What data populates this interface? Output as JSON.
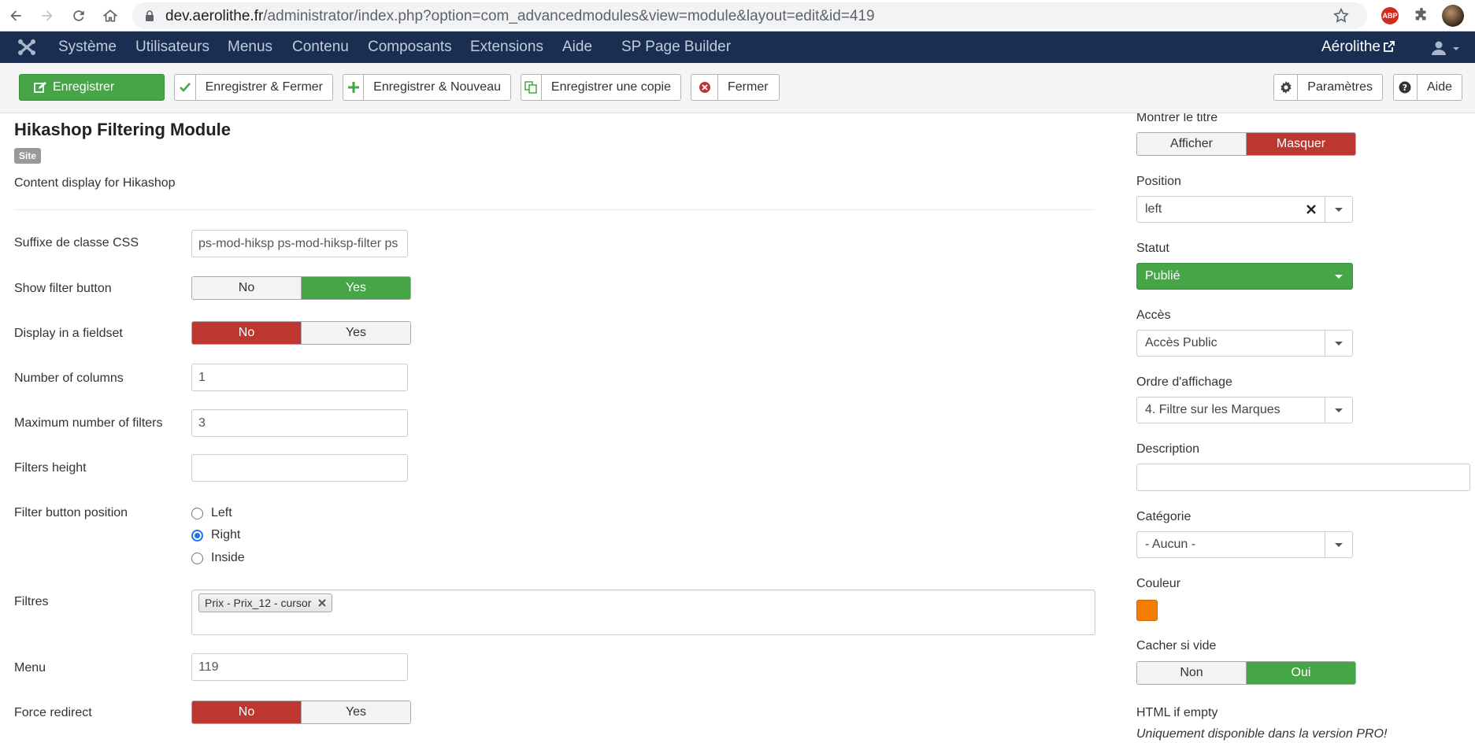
{
  "browser": {
    "url_host": "dev.aerolithe.fr",
    "url_path": "/administrator/index.php?option=com_advancedmodules&view=module&layout=edit&id=419",
    "abp_label": "ABP"
  },
  "topnav": {
    "items": [
      "Système",
      "Utilisateurs",
      "Menus",
      "Contenu",
      "Composants",
      "Extensions",
      "Aide",
      "SP Page Builder"
    ],
    "site_name": "Aérolithe"
  },
  "toolbar": {
    "save": "Enregistrer",
    "save_close": "Enregistrer & Fermer",
    "save_new": "Enregistrer & Nouveau",
    "save_copy": "Enregistrer une copie",
    "close": "Fermer",
    "options": "Paramètres",
    "help": "Aide"
  },
  "module": {
    "title": "Hikashop Filtering Module",
    "badge": "Site",
    "description": "Content display for Hikashop"
  },
  "form": {
    "css_suffix": {
      "label": "Suffixe de classe CSS",
      "value": "ps-mod-hiksp ps-mod-hiksp-filter ps"
    },
    "show_filter_button": {
      "label": "Show filter button",
      "no": "No",
      "yes": "Yes",
      "selected": "Yes"
    },
    "fieldset": {
      "label": "Display in a fieldset",
      "no": "No",
      "yes": "Yes",
      "selected": "No"
    },
    "columns": {
      "label": "Number of columns",
      "value": "1"
    },
    "max_filters": {
      "label": "Maximum number of filters",
      "value": "3"
    },
    "filters_height": {
      "label": "Filters height",
      "value": ""
    },
    "button_position": {
      "label": "Filter button position",
      "options": [
        "Left",
        "Right",
        "Inside"
      ],
      "selected": "Right"
    },
    "filters": {
      "label": "Filtres",
      "tags": [
        "Prix - Prix_12 - cursor"
      ]
    },
    "menu": {
      "label": "Menu",
      "value": "119"
    },
    "force_redirect": {
      "label": "Force redirect",
      "no": "No",
      "yes": "Yes",
      "selected": "No"
    }
  },
  "sidebar": {
    "show_title": {
      "label": "Montrer le titre",
      "show": "Afficher",
      "hide": "Masquer",
      "selected": "Masquer"
    },
    "position": {
      "label": "Position",
      "value": "left"
    },
    "status": {
      "label": "Statut",
      "value": "Publié"
    },
    "access": {
      "label": "Accès",
      "value": "Accès Public"
    },
    "ordering": {
      "label": "Ordre d'affichage",
      "value": "4. Filtre sur les Marques"
    },
    "description": {
      "label": "Description",
      "value": ""
    },
    "category": {
      "label": "Catégorie",
      "value": "- Aucun -"
    },
    "color": {
      "label": "Couleur",
      "value": "#f47c00"
    },
    "hide_empty": {
      "label": "Cacher si vide",
      "no": "Non",
      "yes": "Oui",
      "selected": "Oui"
    },
    "html_empty": {
      "label": "HTML if empty",
      "note": "Uniquement disponible dans la version PRO!"
    }
  },
  "colors": {
    "navbar": "#1a2e52",
    "green": "#46a546",
    "red": "#bd362f",
    "swatch": "#f47c00"
  }
}
